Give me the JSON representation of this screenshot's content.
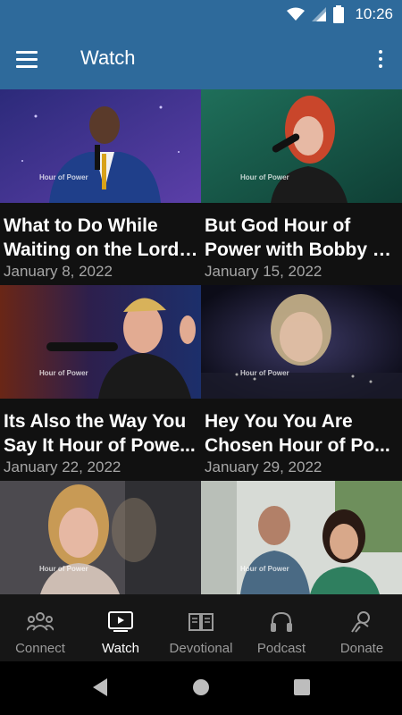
{
  "status": {
    "time": "10:26"
  },
  "app_bar": {
    "title": "Watch"
  },
  "videos": [
    {
      "title_1": "What to Do While",
      "title_2": "Waiting on the Lord ...",
      "date": "January 8, 2022",
      "watermark": "Hour of Power"
    },
    {
      "title_1": "But God Hour of",
      "title_2": "Power with Bobby S...",
      "date": "January 15, 2022",
      "watermark": "Hour of Power"
    },
    {
      "title_1": "Its Also the Way You",
      "title_2": "Say It Hour of Powe...",
      "date": "January 22, 2022",
      "watermark": "Hour of Power"
    },
    {
      "title_1": "Hey You You Are",
      "title_2": "Chosen Hour of Po...",
      "date": "January 29, 2022",
      "watermark": "Hour of Power"
    },
    {
      "title_1": "",
      "title_2": "",
      "date": "",
      "watermark": "Hour of Power"
    },
    {
      "title_1": "",
      "title_2": "",
      "date": "",
      "watermark": "Hour of Power"
    }
  ],
  "bottom_nav": {
    "active": "Watch",
    "items": [
      {
        "label": "Connect",
        "icon": "people-icon"
      },
      {
        "label": "Watch",
        "icon": "video-icon"
      },
      {
        "label": "Devotional",
        "icon": "book-icon"
      },
      {
        "label": "Podcast",
        "icon": "headphones-icon"
      },
      {
        "label": "Donate",
        "icon": "donate-hand-icon"
      }
    ]
  },
  "colors": {
    "app_bar": "#2e6a9b",
    "background": "#111111",
    "nav_active": "#ffffff",
    "nav_inactive": "#9a9a9a",
    "date_text": "#a6a6a6"
  }
}
